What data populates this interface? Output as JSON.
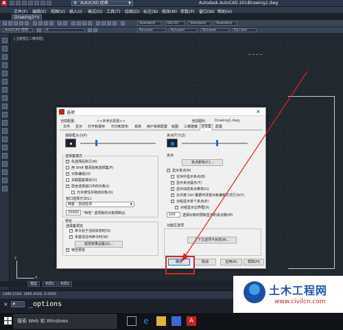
{
  "titlebar": {
    "app_logo": "A",
    "workspace": "AutoCAD 经典",
    "app_title": "Autodesk AutoCAD 2014",
    "doc_title": "Drawing1.dwg"
  },
  "menubar": {
    "items": [
      "文件(F)",
      "编辑(E)",
      "视图(V)",
      "插入(I)",
      "格式(O)",
      "工具(T)",
      "绘图(D)",
      "标注(N)",
      "修改(M)",
      "参数(P)",
      "窗口(W)",
      "帮助(H)"
    ]
  },
  "toolbar": {
    "combo_workspace": "AutoCAD 经典",
    "combo_text_style": "Standard",
    "combo_dim_style": "ISO-25",
    "combo_table_style": "Standard",
    "combo_ml_style": "Standard",
    "combo_layer": "0",
    "combo_color": "ByLayer",
    "combo_linetype": "ByLayer",
    "combo_lineweight": "ByLayer",
    "combo_plot": "ByColor"
  },
  "tabs": {
    "drawing_tab": "Drawing1*",
    "close": "×"
  },
  "viewport": {
    "label": "[-][俯视][二维线框]"
  },
  "ucs": {
    "x": "X",
    "y": "Y"
  },
  "layout_tabs": [
    "模型",
    "布局1",
    "布局2"
  ],
  "statusbar": {
    "coords": "1880.3164, 1885.4026, 0.0000"
  },
  "cmdline": {
    "close": "×",
    "prompt_icon": "▶",
    "text": "_options"
  },
  "taskbar": {
    "search_placeholder": "搜索 Web 和 Windows"
  },
  "watermark": {
    "title": "土木工程网",
    "url": "www.civilcn.com"
  },
  "dialog": {
    "title": "选项",
    "close": "×",
    "current_profile_label": "当前配置:",
    "current_profile_value": "<<未命名配置>>",
    "current_drawing_label": "当前图形:",
    "current_drawing_value": "Drawing1.dwg",
    "tabs": [
      "文件",
      "显示",
      "打开和保存",
      "打印和发布",
      "系统",
      "用户系统配置",
      "绘图",
      "三维建模",
      "选择集",
      "配置"
    ],
    "pickbox_label": "拾取框大小(P)",
    "grip_size_label": "夹点尺寸(Z)",
    "selection_mode_label": "选择集模式",
    "selection_modes": [
      {
        "label": "先选择后执行(N)",
        "checked": true
      },
      {
        "label": "用 Shift 键添加到选择集(F)",
        "checked": false
      },
      {
        "label": "对象编组(O)",
        "checked": true
      },
      {
        "label": "关联图案填充(V)",
        "checked": false
      },
      {
        "label": "隐含选择窗口中的对象(I)",
        "checked": true
      },
      {
        "label": "允许按住并拖动对象(D)",
        "checked": false
      }
    ],
    "window_method_label": "窗口选择方法(L):",
    "window_method_value": "两者 - 自动检测",
    "property_limit_value": "25000",
    "property_limit_label": "\"特性\" 选项板的对象限制(J)",
    "preview_label": "预览",
    "preview_selection_label": "选择集预览",
    "preview_options": [
      {
        "label": "命令处于活动状态时(S)",
        "checked": true
      },
      {
        "label": "未激活任何命令时(W)",
        "checked": true
      }
    ],
    "visual_effects_button": "视觉效果设置(G)...",
    "property_preview_label": "特性预览",
    "property_preview_checked": true,
    "grips_label": "夹点",
    "grip_colors_button": "夹点颜色(C)...",
    "grip_options": [
      {
        "label": "显示夹点(R)",
        "checked": true,
        "dim": false
      },
      {
        "label": "在块中显示夹点(B)",
        "checked": false,
        "dim": false
      },
      {
        "label": "显示夹点提示(T)",
        "checked": true,
        "dim": false
      },
      {
        "label": "显示动态夹点菜单(U)",
        "checked": true,
        "dim": false
      },
      {
        "label": "允许按 Ctrl 键循环改变对象编辑方式行为(Y)",
        "checked": true,
        "dim": false
      },
      {
        "label": "对组显示单个夹点(E)",
        "checked": true,
        "dim": false
      },
      {
        "label": "对组显示边界框(X)",
        "checked": true,
        "dim": false
      }
    ],
    "grip_limit_value": "100",
    "grip_limit_label": "选择对象时限制显示的夹点数(M)",
    "ribbon_label": "功能区选项",
    "ribbon_button": "上下文选项卡状态(A)...",
    "ok_button": "确定",
    "cancel_button": "取消",
    "apply_button": "应用(A)",
    "help_button": "帮助(H)"
  },
  "colors": {
    "drawing_bg": "#212830",
    "dialog_bg": "#f0f0f0",
    "annotation_red": "#e0241b",
    "watermark_blue": "#1e56b8"
  }
}
